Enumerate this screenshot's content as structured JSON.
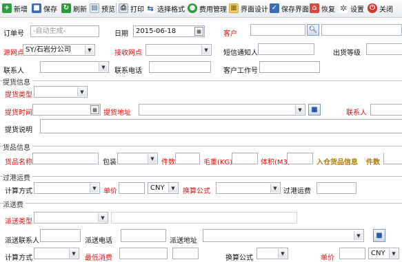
{
  "toolbar": {
    "items": [
      {
        "label": "新增",
        "icon": "add-icon"
      },
      {
        "label": "保存",
        "icon": "save-icon"
      },
      {
        "label": "刷新",
        "icon": "refresh-icon"
      },
      {
        "label": "预览",
        "icon": "preview-icon"
      },
      {
        "label": "打印",
        "icon": "print-icon"
      },
      {
        "label": "选择格式",
        "icon": "format-icon"
      },
      {
        "label": "费用管理",
        "icon": "fee-icon"
      },
      {
        "label": "界面设计",
        "icon": "design-icon"
      },
      {
        "label": "保存界面",
        "icon": "save-layout-icon"
      },
      {
        "label": "恢复",
        "icon": "restore-icon"
      },
      {
        "label": "设置",
        "icon": "settings-icon"
      },
      {
        "label": "关闭",
        "icon": "close-icon"
      }
    ]
  },
  "order": {
    "order_no_label": "订单号",
    "order_no_placeholder": "-自动生成-",
    "date_label": "日期",
    "date_value": "2015-06-18",
    "customer_label": "客户",
    "source_branch_label": "源网点",
    "source_branch_value": "SY/石岩分公司",
    "receive_branch_label": "接收网点",
    "sms_notify_label": "短信通知人",
    "ship_level_label": "出货等级",
    "contact_label": "联系人",
    "contact_phone_label": "联系电话",
    "customer_job_no_label": "客户工作号"
  },
  "pickup": {
    "section_title": "提货信息",
    "type_label": "提货类型",
    "time_label": "提货时间",
    "address_label": "提货地址",
    "contact_label": "联系人",
    "note_label": "提货说明"
  },
  "goods": {
    "section_title": "货品信息",
    "name_label": "货品名称",
    "package_label": "包装",
    "pieces_label": "件数",
    "weight_label": "毛重(KG)",
    "volume_label": "体积(M3)",
    "warehouse_label": "入仓货品信息",
    "warehouse_pieces_label": "件数"
  },
  "transit": {
    "section_title": "过港运费",
    "calc_label": "计算方式",
    "unit_price_label": "单价",
    "currency": "CNY",
    "formula_label": "换算公式",
    "fee_label": "过港运费"
  },
  "delivery": {
    "section_title": "派送费",
    "type_label": "派送类型",
    "contact_label": "派送联系人",
    "phone_label": "派送电话",
    "address_label": "派送地址",
    "calc_label": "计算方式",
    "min_fee_label": "最低消费",
    "formula_label": "换算公式",
    "unit_price_label": "单价",
    "currency": "CNY"
  }
}
